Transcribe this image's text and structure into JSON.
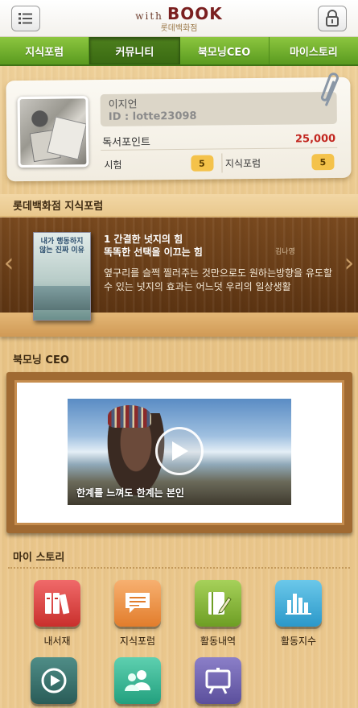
{
  "header": {
    "logo_with": "with",
    "logo_book": "BOOK",
    "logo_sub": "롯데백화점",
    "menu_icon": "list-menu-icon",
    "lock_icon": "lock-icon"
  },
  "nav": {
    "tabs": [
      {
        "label": "지식포럼",
        "active": false
      },
      {
        "label": "커뮤니티",
        "active": true
      },
      {
        "label": "북모닝CEO",
        "active": false
      },
      {
        "label": "마이스토리",
        "active": false
      }
    ]
  },
  "profile": {
    "name": "이지언",
    "id_text": "ID : lotte23098",
    "points_label": "독서포인트",
    "points_value": "25,000",
    "stats": [
      {
        "label": "시험",
        "count": "5"
      },
      {
        "label": "지식포럼",
        "count": "5"
      }
    ]
  },
  "forum": {
    "section_title": "롯데백화점 지식포럼",
    "book_cover_title": "내가 행동하지 않는 진짜 이유",
    "title_line1": "1 간결한 넛지의 힘",
    "title_line2": "똑똑한 선택을 이끄는 힘",
    "author": "김나영",
    "description": "옆구리를 슬쩍 찔러주는 것만으로도 원하는방향을 유도할 수 있는 넛지의 효과는 어느덧 우리의 일상생활",
    "prev_arrow": "‹",
    "next_arrow": "›"
  },
  "ceo": {
    "section_title": "북모닝 CEO",
    "video_caption": "한계를 느껴도 한계는 본인"
  },
  "mystory": {
    "section_title": "마이 스토리",
    "items": [
      {
        "label": "내서재",
        "icon": "bookshelf-icon"
      },
      {
        "label": "지식포럼",
        "icon": "chat-bubble-icon"
      },
      {
        "label": "활동내역",
        "icon": "notebook-pen-icon"
      },
      {
        "label": "활동지수",
        "icon": "bar-chart-icon"
      },
      {
        "label": "",
        "icon": "play-circle-icon"
      },
      {
        "label": "",
        "icon": "people-icon"
      },
      {
        "label": "",
        "icon": "presentation-board-icon"
      }
    ]
  },
  "colors": {
    "nav_green": "#6aac2a",
    "points_red": "#c2261f",
    "badge_yellow": "#f4c24a",
    "wood_dark": "#5c3412"
  }
}
